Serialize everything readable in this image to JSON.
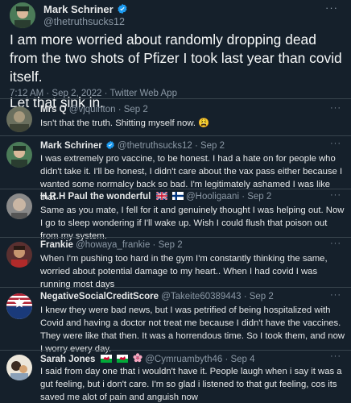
{
  "main": {
    "name": "Mark Schriner",
    "handle": "@thetruthsucks12",
    "text_1": "I am more worried about randomly dropping dead from the two shots of Pfizer I took last year than covid itself.",
    "text_2": "Let that sink in.",
    "meta": "7:12 AM · Sep 2, 2022 · Twitter Web App",
    "more": "···"
  },
  "replies": [
    {
      "name": "Mrs Q",
      "handle": "@vjquinton · Sep 2",
      "text": "Isn't that the truth. Shitting myself now. 😩",
      "avatar_color": "#6a6f5e"
    },
    {
      "name": "Mark Schriner",
      "handle": "@thetruthsucks12 · Sep 2",
      "text": "I was extremely pro vaccine, to be honest. I had a hate on for people who didn't take it. I'll be honest, I didn't care about the vax pass either because I wanted some normalcy back so bad. I'm legitimately ashamed I was like that",
      "avatar_color": "#2e5e3d"
    },
    {
      "name": "H.R.H Paul the wonderful",
      "handle": "@Hooligaani · Sep 2",
      "text": "Same as you mate, I fell for it and genuinely thought I was helping out. Now I go to sleep wondering if I'll wake up. Wish I could flush that poison out from my system.",
      "avatar_color": "#7a7a7a"
    },
    {
      "name": "Frankie",
      "handle": "@howaya_frankie · Sep 2",
      "text": "When I'm pushing too hard in the gym I'm constantly thinking the same, worried about potential damage to my heart.. When I had covid I was running most days",
      "avatar_color": "#8a3a3a"
    },
    {
      "name": "NegativeSocialCreditScore",
      "handle": "@Takeite60389443 · Sep 2",
      "text": "I knew they were bad news, but I was petrified of being hospitalized with Covid and having a doctor not treat me because I didn't have the vaccines. They were like that then. It was a horrendous time. So I took them, and now I worry every day.",
      "avatar_color": "#1a3a7a"
    },
    {
      "name": "Sarah Jones",
      "handle": "@Cymruambyth46 · Sep 4",
      "text": "I said from day one that i wouldn't have it. People laugh when i say it was a gut feeling, but i don't care. I'm so glad i listened to that gut feeling, cos its saved me alot of pain and anguish now",
      "avatar_color": "#e8e2d8"
    }
  ],
  "colors": {
    "background": "#15202b",
    "text": "#e7e9ea",
    "secondary_text": "#8b98a5",
    "divider": "#38444d",
    "verified": "#1d9bf0"
  }
}
